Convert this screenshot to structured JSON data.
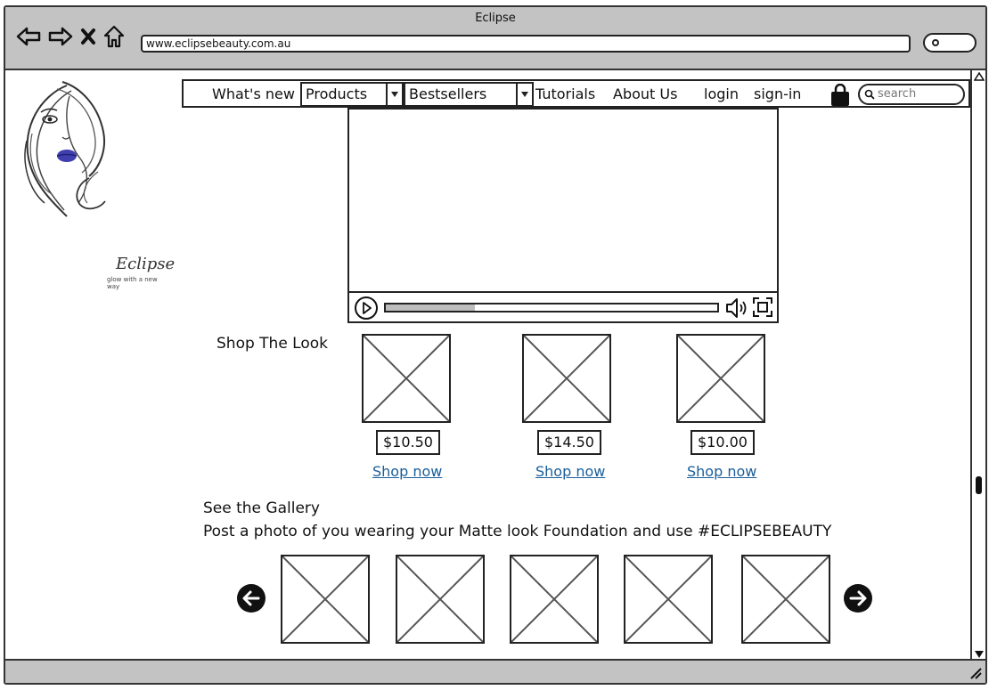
{
  "browser": {
    "title": "Eclipse",
    "url": "www.eclipsebeauty.com.au"
  },
  "logo": {
    "name": "Eclipse",
    "tagline": "glow with a new way"
  },
  "nav": {
    "whats_new": "What's new",
    "products": "Products",
    "bestsellers": "Bestsellers",
    "tutorials": "Tutorials",
    "about": "About Us",
    "login": "login",
    "signin": "sign-in",
    "search_placeholder": "search"
  },
  "video": {
    "progress": 0.27
  },
  "shop_the_look": {
    "heading": "Shop The Look",
    "items": [
      {
        "price": "$10.50",
        "link": "Shop now"
      },
      {
        "price": "$14.50",
        "link": "Shop now"
      },
      {
        "price": "$10.00",
        "link": "Shop now"
      }
    ]
  },
  "gallery": {
    "heading": "See the Gallery",
    "subheading": "Post a photo of you wearing your Matte look Foundation and use #ECLIPSEBEAUTY",
    "image_count": 5
  },
  "colors": {
    "chrome": "#c3c3c3",
    "link": "#1a5e9a",
    "lips": "#3f3fb0"
  }
}
